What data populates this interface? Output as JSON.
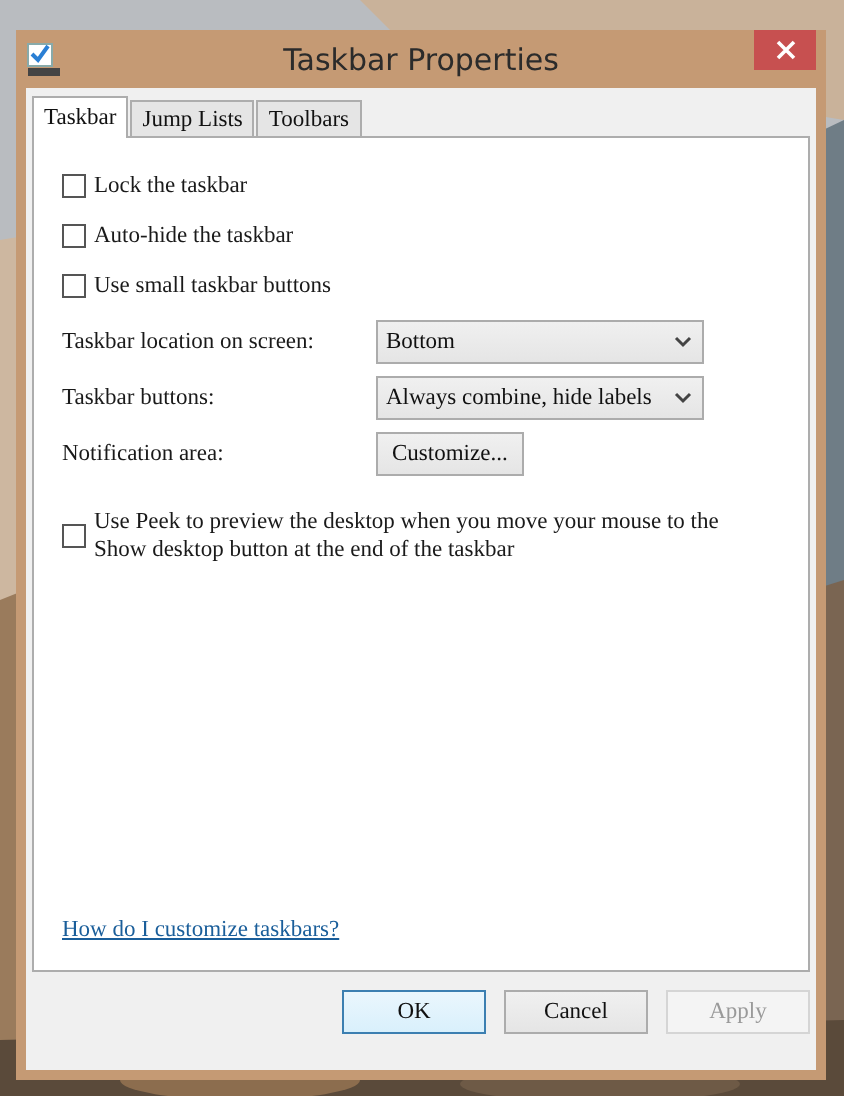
{
  "window": {
    "title": "Taskbar Properties"
  },
  "tabs": [
    {
      "label": "Taskbar",
      "selected": true
    },
    {
      "label": "Jump Lists",
      "selected": false
    },
    {
      "label": "Toolbars",
      "selected": false
    }
  ],
  "options": [
    {
      "label": "Lock the taskbar",
      "checked": false
    },
    {
      "label": "Auto-hide the taskbar",
      "checked": false
    },
    {
      "label": "Use small taskbar buttons",
      "checked": false
    }
  ],
  "settings": [
    {
      "kind": "dropdown",
      "label": "Taskbar location on screen:",
      "value": "Bottom"
    },
    {
      "kind": "dropdown",
      "label": "Taskbar buttons:",
      "value": "Always combine, hide labels"
    },
    {
      "kind": "button",
      "label": "Notification area:",
      "value": "Customize..."
    }
  ],
  "peek": {
    "label": "Use Peek to preview the desktop when you move your mouse to the Show desktop button at the end of the taskbar",
    "checked": false
  },
  "help_link": "How do I customize taskbars?",
  "buttons": [
    {
      "label": "OK",
      "default": true,
      "disabled": false
    },
    {
      "label": "Cancel",
      "default": false,
      "disabled": false
    },
    {
      "label": "Apply",
      "default": false,
      "disabled": true
    }
  ]
}
